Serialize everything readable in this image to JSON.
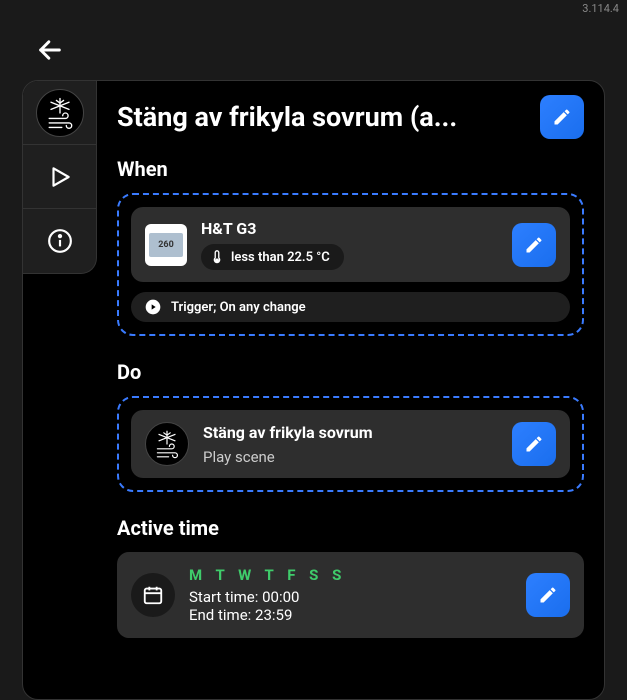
{
  "version": "3.114.4",
  "title": "Stäng av frikyla sovrum (a...",
  "sections": {
    "when": {
      "label": "When"
    },
    "do": {
      "label": "Do"
    },
    "active_time": {
      "label": "Active time"
    }
  },
  "when_card": {
    "device_name": "H&T G3",
    "thumb_text": "260",
    "condition": "less than 22.5 °C",
    "trigger_text": "Trigger; On any change"
  },
  "do_card": {
    "title": "Stäng av frikyla sovrum",
    "subtitle": "Play scene"
  },
  "active_time_card": {
    "days": "M T W T F S S",
    "start_label": "Start time:",
    "start_value": "00:00",
    "end_label": "End time:",
    "end_value": "23:59"
  }
}
